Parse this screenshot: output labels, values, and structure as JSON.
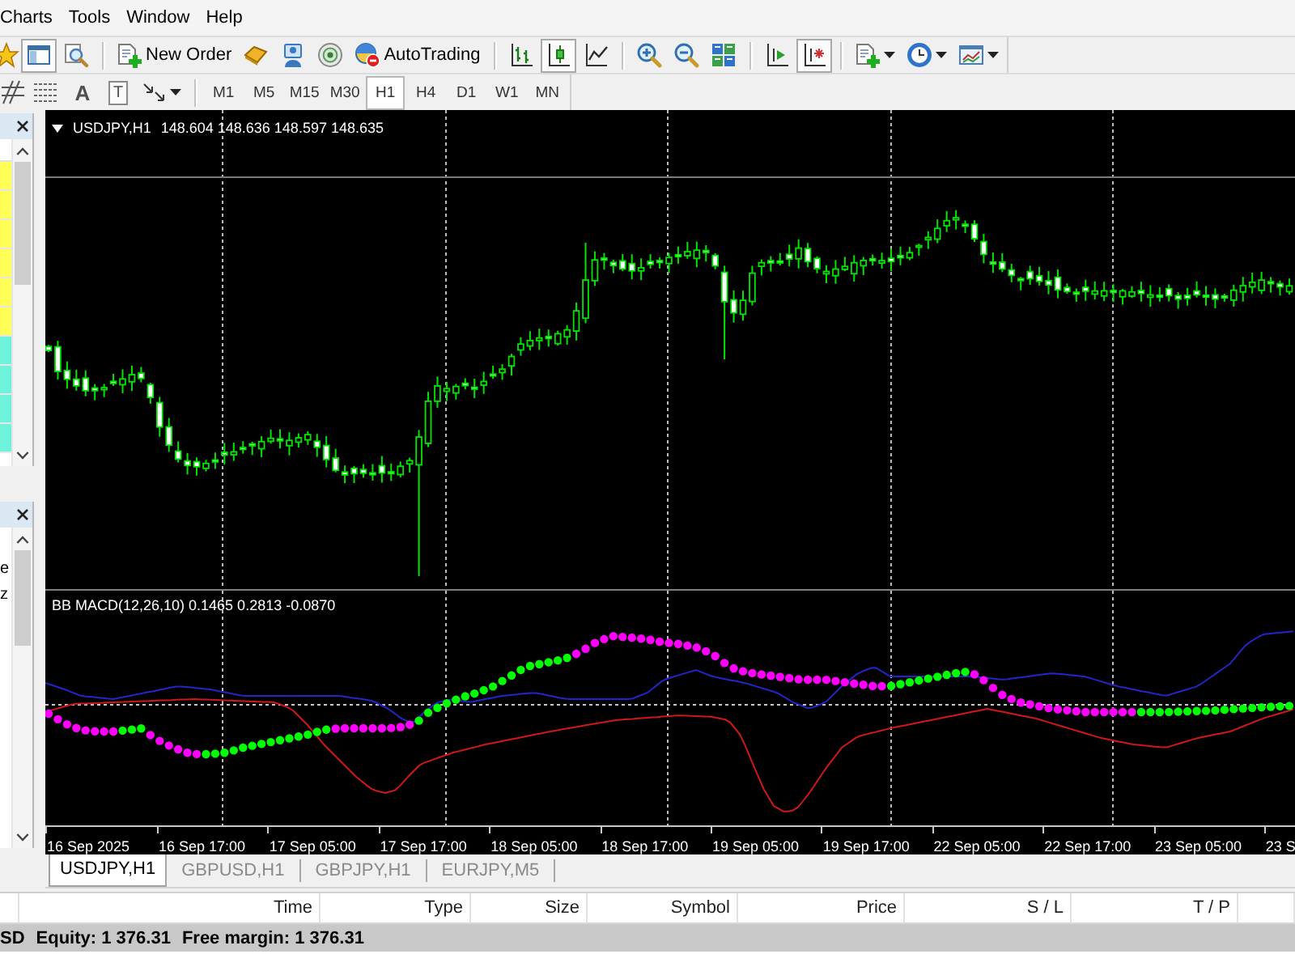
{
  "menu": [
    {
      "label": "Charts"
    },
    {
      "label": "Tools"
    },
    {
      "label": "Window"
    },
    {
      "label": "Help"
    }
  ],
  "toolbar": {
    "panel_pressed": true,
    "new_order": "New Order",
    "auto_trading": "AutoTrading",
    "chart_types": [
      {
        "selected": false
      },
      {
        "selected": true
      },
      {
        "selected": false
      }
    ],
    "chart_shift_pressed": false,
    "auto_scroll_pressed": true
  },
  "drawing_tools": {
    "text_tool": "A",
    "label_tool": "T"
  },
  "timeframes": [
    {
      "label": "M1",
      "selected": false
    },
    {
      "label": "M5",
      "selected": false
    },
    {
      "label": "M15",
      "selected": false
    },
    {
      "label": "M30",
      "selected": false
    },
    {
      "label": "H1",
      "selected": true
    },
    {
      "label": "H4",
      "selected": false
    },
    {
      "label": "D1",
      "selected": false
    },
    {
      "label": "W1",
      "selected": false
    },
    {
      "label": "MN",
      "selected": false
    }
  ],
  "market_watch": {
    "rows": [
      {
        "color": "#ffff55"
      },
      {
        "color": "#ffff55"
      },
      {
        "color": "#ffff55"
      },
      {
        "color": "#ffff55"
      },
      {
        "color": "#ffff55"
      },
      {
        "color": "#ffff55"
      },
      {
        "color": "#6ff2dc"
      },
      {
        "color": "#6ff2dc"
      },
      {
        "color": "#6ff2dc"
      },
      {
        "color": "#6ff2dc"
      }
    ]
  },
  "navigator": {
    "items": [
      "e",
      "z"
    ]
  },
  "chart": {
    "symbol": "USDJPY,H1",
    "prices": "148.604 148.636 148.597 148.635",
    "indicator": "BB MACD(12,26,10) 0.1465 0.2813 -0.0870",
    "time_labels": [
      "16 Sep 2025",
      "16 Sep 17:00",
      "17 Sep 05:00",
      "17 Sep 17:00",
      "18 Sep 05:00",
      "18 Sep 17:00",
      "19 Sep 05:00",
      "19 Sep 17:00",
      "22 Sep 05:00",
      "22 Sep 17:00",
      "23 Sep 05:00",
      "23 S"
    ]
  },
  "chart_tabs": [
    {
      "label": "USDJPY,H1",
      "selected": true
    },
    {
      "label": "GBPUSD,H1",
      "selected": false
    },
    {
      "label": "GBPJPY,H1",
      "selected": false
    },
    {
      "label": "EURJPY,M5",
      "selected": false
    }
  ],
  "terminal": {
    "columns": [
      "Time",
      "Type",
      "Size",
      "Symbol",
      "Price",
      "S / L",
      "T / P"
    ],
    "account": [
      "SD",
      "Equity: 1 376.31",
      "Free margin: 1 376.31"
    ]
  }
}
